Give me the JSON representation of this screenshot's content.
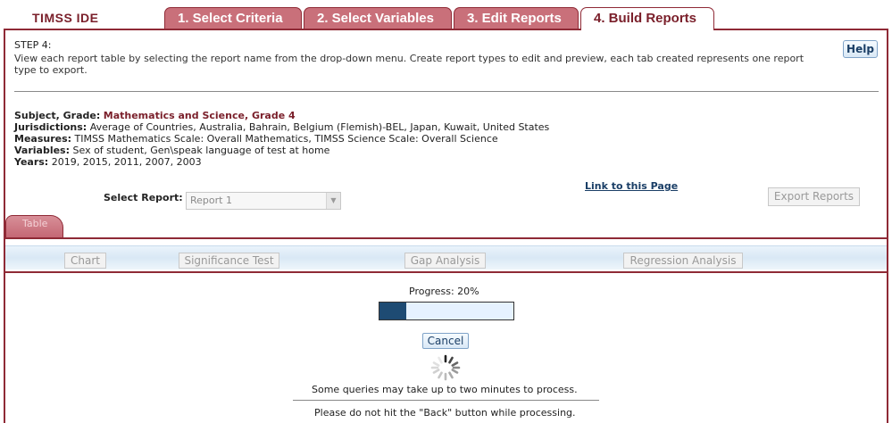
{
  "app": {
    "logo": "TIMSS IDE"
  },
  "tabs": [
    {
      "label": "1. Select Criteria"
    },
    {
      "label": "2. Select Variables"
    },
    {
      "label": "3. Edit Reports"
    },
    {
      "label": "4. Build Reports",
      "active": true
    }
  ],
  "step": {
    "title": "STEP 4:",
    "description": "View each report table by selecting the report name from the drop-down menu. Create report types to edit and preview, each tab created represents one report type to export.",
    "help_label": "Help"
  },
  "summary": {
    "subject_label": "Subject, Grade:",
    "subject_value": "Mathematics and Science, Grade 4",
    "jurisdictions_label": "Jurisdictions:",
    "jurisdictions_value": "Average of Countries, Australia, Bahrain, Belgium (Flemish)-BEL, Japan, Kuwait, United States",
    "measures_label": "Measures:",
    "measures_value": "TIMSS Mathematics Scale: Overall Mathematics, TIMSS Science Scale: Overall Science",
    "variables_label": "Variables:",
    "variables_value": "Sex of student, Gen\\speak language of test at home",
    "years_label": "Years:",
    "years_value": "2019, 2015, 2011, 2007, 2003"
  },
  "report": {
    "link_label": "Link to this Page",
    "select_label": "Select Report:",
    "select_value": "Report 1",
    "export_label": "Export Reports"
  },
  "view_tabs": {
    "table_label": "Table",
    "chart_label": "Chart",
    "significance_label": "Significance Test",
    "gap_label": "Gap Analysis",
    "regression_label": "Regression Analysis"
  },
  "progress": {
    "label": "Progress: 20%",
    "fraction": 0.2,
    "cancel_label": "Cancel",
    "message1": "Some queries may take up to two minutes to process.",
    "message2": "Please do not hit the \"Back\" button while processing."
  },
  "colors": {
    "brand": "#8f2a36",
    "tab_inactive": "#c9707a",
    "progress_fill": "#1e4b73",
    "progress_track": "#e6f2ff"
  }
}
